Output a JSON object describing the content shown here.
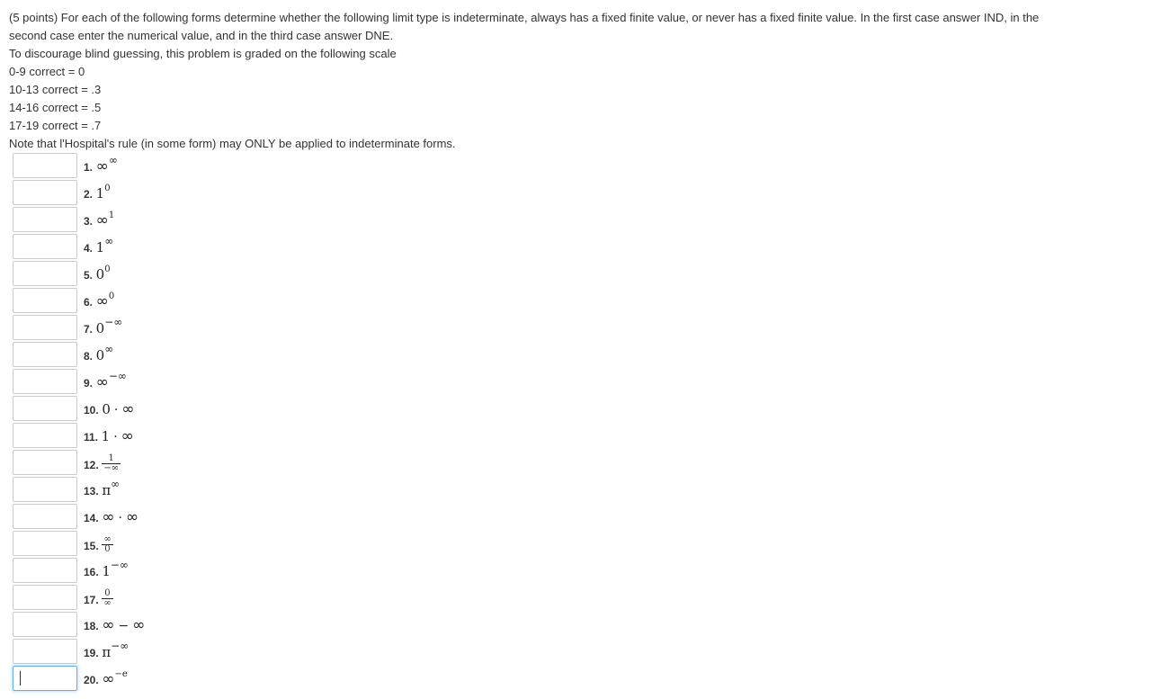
{
  "problem": {
    "instructions_line1": "(5 points) For each of the following forms determine whether the following limit type is indeterminate, always has a fixed finite value, or never has a fixed finite value. In the first case answer IND, in the",
    "instructions_line2": "second case enter the numerical value, and in the third case answer DNE.",
    "scale_intro": "To discourage blind guessing, this problem is graded on the following scale",
    "scale": [
      "0-9 correct = 0",
      "10-13 correct = .3",
      "14-16 correct = .5",
      "17-19 correct = .7"
    ],
    "note": "Note that l'Hospital's rule (in some form) may ONLY be applied to indeterminate forms."
  },
  "items": [
    {
      "n": "1.",
      "base": "∞",
      "exp": "∞"
    },
    {
      "n": "2.",
      "base": "1",
      "exp": "0"
    },
    {
      "n": "3.",
      "base": "∞",
      "exp": "1"
    },
    {
      "n": "4.",
      "base": "1",
      "exp": "∞"
    },
    {
      "n": "5.",
      "base": "0",
      "exp": "0"
    },
    {
      "n": "6.",
      "base": "∞",
      "exp": "0"
    },
    {
      "n": "7.",
      "base": "0",
      "exp": "−∞"
    },
    {
      "n": "8.",
      "base": "0",
      "exp": "∞"
    },
    {
      "n": "9.",
      "base": "∞",
      "exp": "−∞"
    },
    {
      "n": "10.",
      "left": "0",
      "op": "·",
      "right": "∞"
    },
    {
      "n": "11.",
      "left": "1",
      "op": "·",
      "right": "∞"
    },
    {
      "n": "12.",
      "num": "1",
      "den": "−∞"
    },
    {
      "n": "13.",
      "base": "π",
      "exp": "∞"
    },
    {
      "n": "14.",
      "left": "∞",
      "op": "·",
      "right": "∞"
    },
    {
      "n": "15.",
      "num": "∞",
      "den": "0"
    },
    {
      "n": "16.",
      "base": "1",
      "exp": "−∞"
    },
    {
      "n": "17.",
      "num": "0",
      "den": "∞"
    },
    {
      "n": "18.",
      "left": "∞",
      "op": "−",
      "right": "∞"
    },
    {
      "n": "19.",
      "base": "π",
      "exp": "−∞"
    },
    {
      "n": "20.",
      "base": "∞",
      "exp": "−e"
    }
  ],
  "answers": [
    "",
    "",
    "",
    "",
    "",
    "",
    "",
    "",
    "",
    "",
    "",
    "",
    "",
    "",
    "",
    "",
    "",
    "",
    "",
    ""
  ],
  "focused_item": 20,
  "colors": {
    "text": "#333333",
    "box_border": "#cccccc",
    "focus_border": "#66afe9"
  }
}
